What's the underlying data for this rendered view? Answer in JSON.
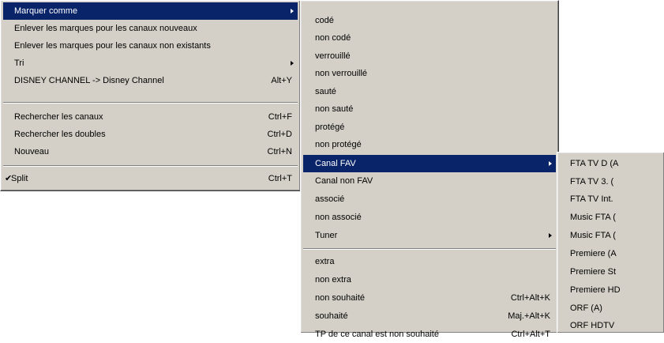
{
  "menu1": {
    "mark_as": "Marquer comme",
    "remove_new": "Enlever les marques pour les canaux nouveaux",
    "remove_nonexistent": "Enlever les marques pour les canaux non existants",
    "sort": "Tri",
    "rename": "DISNEY CHANNEL -> Disney Channel",
    "rename_shortcut": "Alt+Y",
    "search_channels": "Rechercher les canaux",
    "search_channels_shortcut": "Ctrl+F",
    "search_duplicates": "Rechercher les doubles",
    "search_duplicates_shortcut": "Ctrl+D",
    "new": "Nouveau",
    "new_shortcut": "Ctrl+N",
    "split_check": "✔",
    "split": "Split",
    "split_shortcut": "Ctrl+T"
  },
  "menu2": {
    "items": [
      {
        "label": "codé"
      },
      {
        "label": "non codé"
      },
      {
        "label": "verrouillé"
      },
      {
        "label": "non verrouillé"
      },
      {
        "label": "sauté"
      },
      {
        "label": "non sauté"
      },
      {
        "label": "protégé"
      },
      {
        "label": "non protégé"
      },
      {
        "label": "Canal FAV"
      },
      {
        "label": "Canal non FAV"
      },
      {
        "label": "associé"
      },
      {
        "label": "non associé"
      },
      {
        "label": "Tuner"
      },
      {
        "label": "extra"
      },
      {
        "label": "non extra"
      },
      {
        "label": "non souhaité",
        "shortcut": "Ctrl+Alt+K"
      },
      {
        "label": "souhaité",
        "shortcut": "Maj.+Alt+K"
      },
      {
        "label": "TP de ce canal est non souhaité",
        "shortcut": "Ctrl+Alt+T"
      }
    ]
  },
  "menu3": {
    "items": [
      {
        "label": "FTA TV D (A"
      },
      {
        "label": "FTA TV 3. ("
      },
      {
        "label": "FTA TV Int."
      },
      {
        "label": "Music FTA ("
      },
      {
        "label": "Music FTA ("
      },
      {
        "label": "Premiere (A"
      },
      {
        "label": "Premiere St"
      },
      {
        "label": "Premiere HD"
      },
      {
        "label": "ORF (A)"
      },
      {
        "label": "ORF HDTV"
      }
    ]
  },
  "colors": {
    "menu_bg": "#d4d0c8",
    "highlight_bg": "#0a246a",
    "highlight_fg": "#ffffff"
  }
}
